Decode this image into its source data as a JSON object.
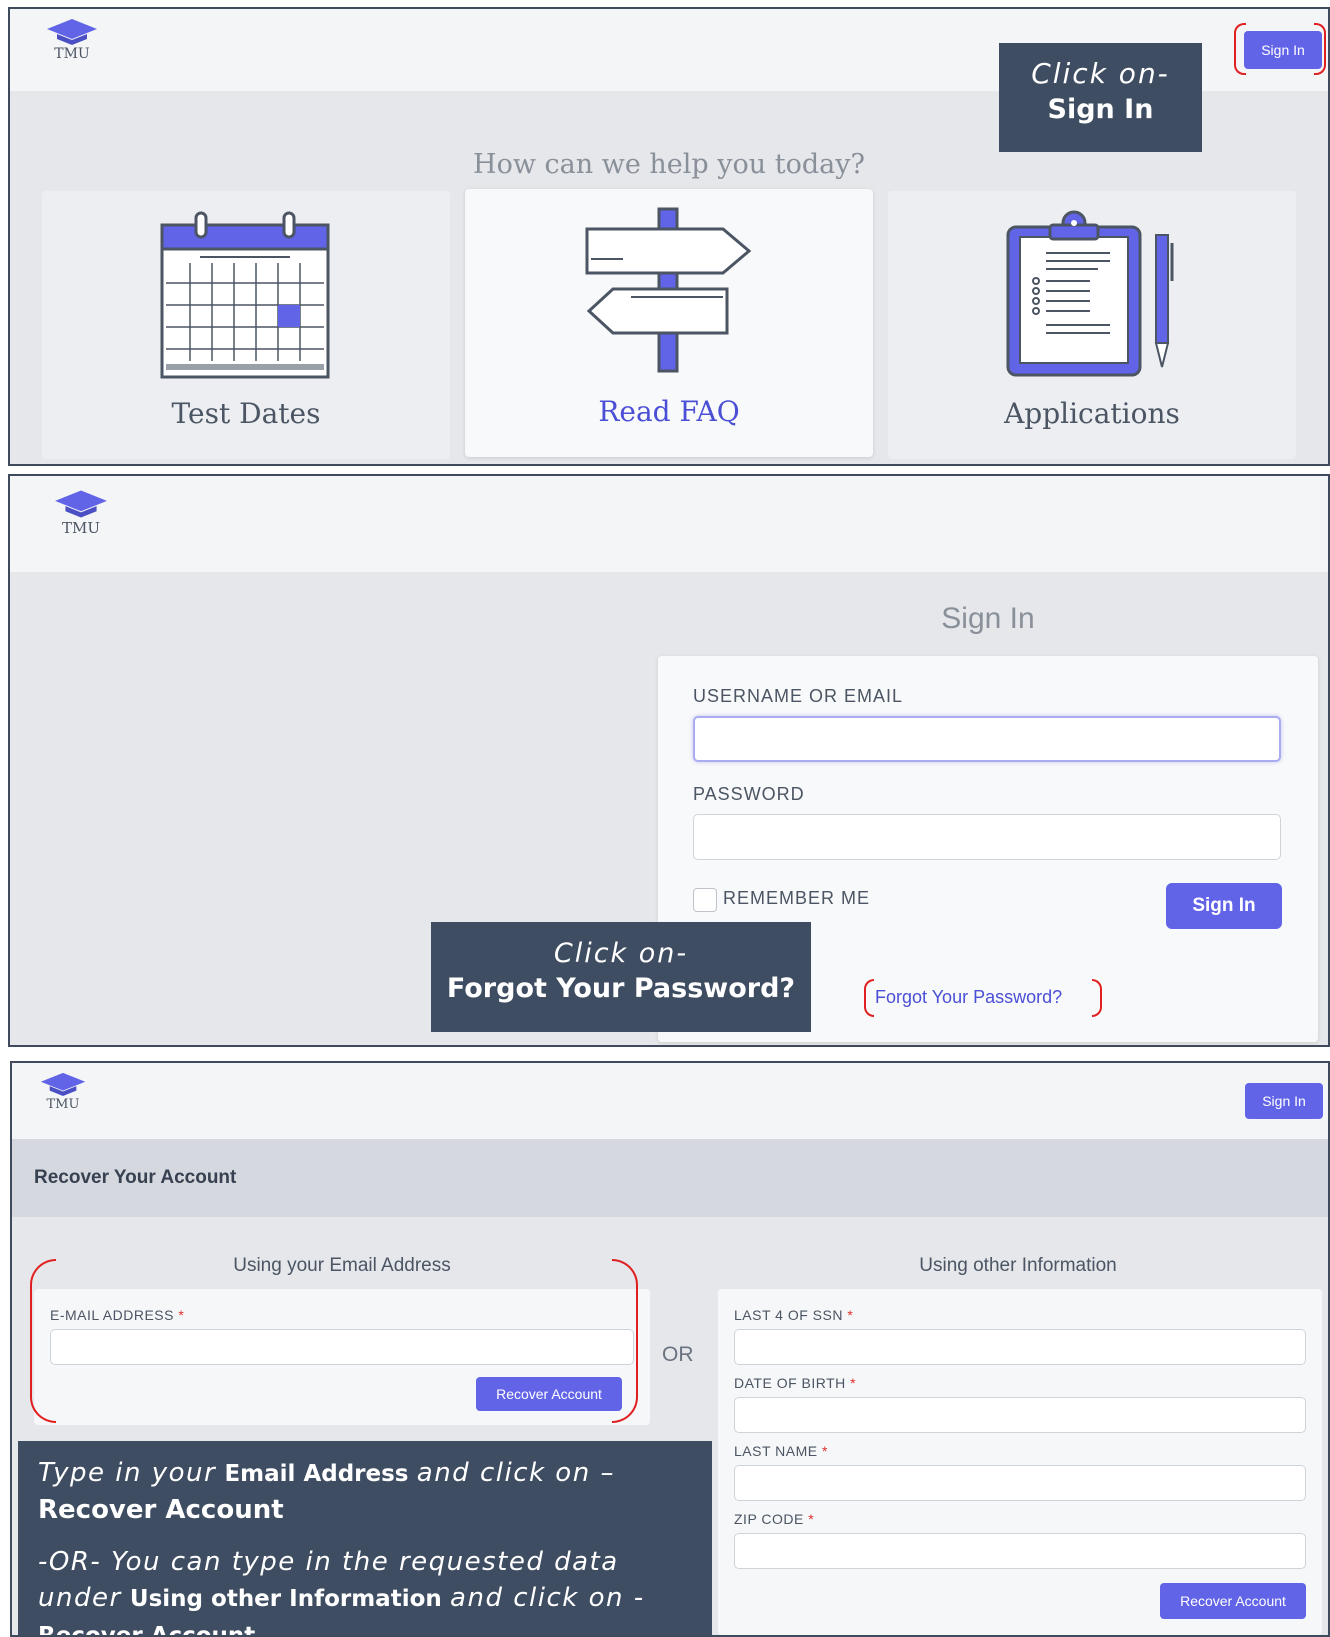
{
  "panel1": {
    "logo_text": "TMU",
    "signin_button": "Sign In",
    "callout_line1": "Click on-",
    "callout_line2": "Sign In",
    "heading": "How can we help you today?",
    "cards": [
      {
        "label": "Test Dates",
        "icon": "calendar-icon"
      },
      {
        "label": "Read FAQ",
        "icon": "signpost-icon"
      },
      {
        "label": "Applications",
        "icon": "clipboard-icon"
      }
    ]
  },
  "panel2": {
    "logo_text": "TMU",
    "title": "Sign In",
    "username_label": "USERNAME OR EMAIL",
    "username_value": "",
    "password_label": "PASSWORD",
    "password_value": "",
    "remember_label": "REMEMBER ME",
    "signin_button": "Sign In",
    "forgot_link": "Forgot Your Password?",
    "callout_line1": "Click on-",
    "callout_line2": "Forgot Your Password?"
  },
  "panel3": {
    "logo_text": "TMU",
    "signin_button": "Sign In",
    "page_title": "Recover Your Account",
    "email_section_title": "Using your Email Address",
    "email_label": "E-MAIL ADDRESS",
    "email_value": "",
    "recover_button": "Recover Account",
    "or_text": "OR",
    "other_section_title": "Using other Information",
    "ssn_label": "LAST 4 OF SSN",
    "dob_label": "DATE OF BIRTH",
    "lastname_label": "LAST NAME",
    "zip_label": "ZIP CODE",
    "required_mark": "*",
    "recover_button_2": "Recover Account",
    "callout": {
      "p1_a": "Type in your",
      "p1_b": "Email Address",
      "p1_c": "and click on –",
      "p1_d": "Recover Account",
      "p2_a": "-OR- You can type in the requested data under",
      "p2_b": "Using other Information",
      "p2_c": "and click on -",
      "p2_d": "Recover Account"
    }
  },
  "colors": {
    "accent": "#6264e8",
    "callout_bg": "#3e4d62",
    "annotation_red": "#e02020",
    "link": "#4a4fd6"
  }
}
